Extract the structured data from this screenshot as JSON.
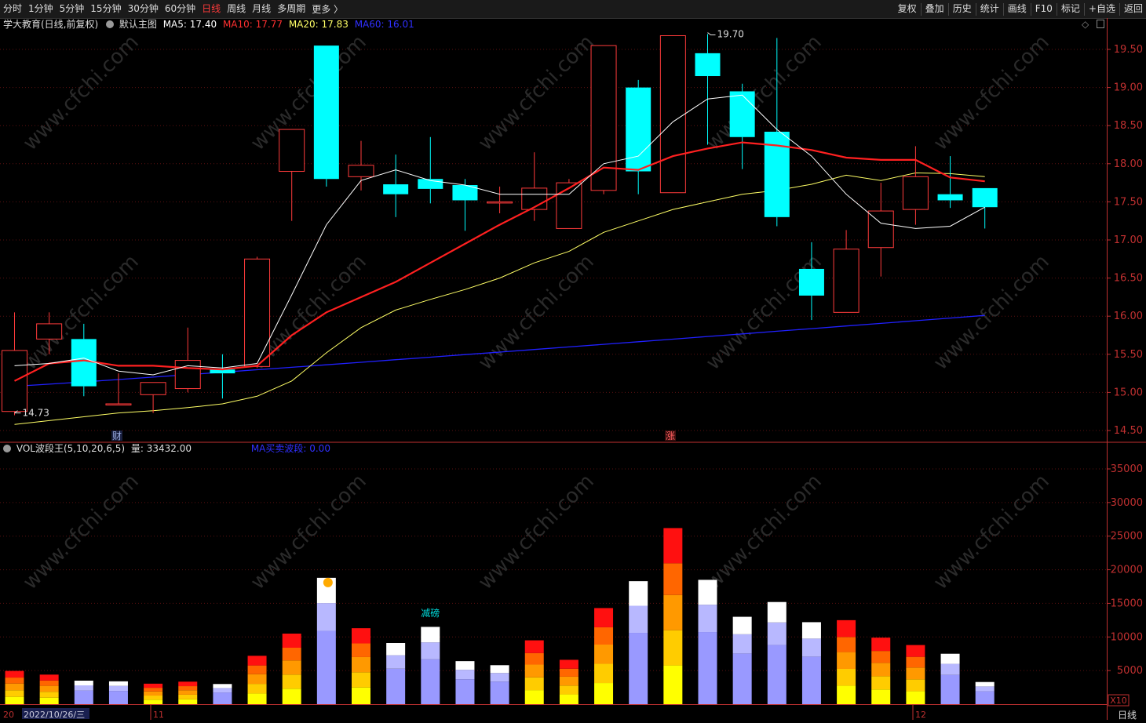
{
  "toolbar": {
    "periods": [
      {
        "label": "分时",
        "active": false
      },
      {
        "label": "1分钟",
        "active": false
      },
      {
        "label": "5分钟",
        "active": false
      },
      {
        "label": "15分钟",
        "active": false
      },
      {
        "label": "30分钟",
        "active": false
      },
      {
        "label": "60分钟",
        "active": false
      },
      {
        "label": "日线",
        "active": true
      },
      {
        "label": "周线",
        "active": false
      },
      {
        "label": "月线",
        "active": false
      },
      {
        "label": "多周期",
        "active": false
      }
    ],
    "more_label": "更多",
    "more_icon": "chevron-right-icon",
    "right_tools": [
      "复权",
      "叠加",
      "历史",
      "统计",
      "画线",
      "F10",
      "标记",
      "+自选",
      "返回"
    ]
  },
  "main_header": {
    "stock": "学大教育(日线,前复权)",
    "indicator": "默认主图",
    "ma5": "MA5: 17.40",
    "ma10": "MA10: 17.77",
    "ma20": "MA20: 17.83",
    "ma60": "MA60: 16.01"
  },
  "vol_header": {
    "name": "VOL波段王(5,10,20,6,5)",
    "volume": "量: 33432.00",
    "ma_label": "MA买卖波段: 0.00"
  },
  "annotations": {
    "high_label": "19.70",
    "low_label": "14.73",
    "cai_mark": "财",
    "zhang_mark": "涨",
    "jianbang": "减磅"
  },
  "bottom": {
    "date_label": "2022/10/26/三",
    "month_11": "11",
    "month_12": "12",
    "x10": "X10",
    "period_label": "日线",
    "left_mark": "20"
  },
  "colors": {
    "bull": "#ff3b3b",
    "bear": "#00ffff",
    "ma5": "#ffffff",
    "ma10": "#ff2020",
    "ma20": "#ffff66",
    "ma60": "#2020ff",
    "axis": "#c03030",
    "grid": "#5a1010"
  },
  "chart_data": [
    {
      "type": "candlestick",
      "y_ticks": [
        14.5,
        15.0,
        15.5,
        16.0,
        16.5,
        17.0,
        17.5,
        18.0,
        18.5,
        19.0,
        19.5
      ],
      "candles": [
        {
          "o": 14.75,
          "h": 16.05,
          "l": 14.7,
          "c": 15.55
        },
        {
          "o": 15.7,
          "h": 16.05,
          "l": 15.5,
          "c": 15.9
        },
        {
          "o": 15.7,
          "h": 15.9,
          "l": 14.95,
          "c": 15.08
        },
        {
          "o": 14.85,
          "h": 15.25,
          "l": 14.83,
          "c": 14.85
        },
        {
          "o": 14.97,
          "h": 15.1,
          "l": 14.73,
          "c": 15.13
        },
        {
          "o": 15.05,
          "h": 15.85,
          "l": 15.0,
          "c": 15.42
        },
        {
          "o": 15.3,
          "h": 15.5,
          "l": 14.92,
          "c": 15.25
        },
        {
          "o": 15.34,
          "h": 16.78,
          "l": 15.32,
          "c": 16.75
        },
        {
          "o": 17.9,
          "h": 18.45,
          "l": 17.25,
          "c": 18.45
        },
        {
          "o": 19.55,
          "h": 19.55,
          "l": 17.7,
          "c": 17.8
        },
        {
          "o": 17.83,
          "h": 18.3,
          "l": 17.65,
          "c": 17.98
        },
        {
          "o": 17.73,
          "h": 18.12,
          "l": 17.3,
          "c": 17.6
        },
        {
          "o": 17.8,
          "h": 18.35,
          "l": 17.48,
          "c": 17.67
        },
        {
          "o": 17.72,
          "h": 17.8,
          "l": 17.12,
          "c": 17.52
        },
        {
          "o": 17.5,
          "h": 17.7,
          "l": 17.35,
          "c": 17.5
        },
        {
          "o": 17.4,
          "h": 18.15,
          "l": 17.25,
          "c": 17.68
        },
        {
          "o": 17.15,
          "h": 17.8,
          "l": 17.15,
          "c": 17.75
        },
        {
          "o": 17.65,
          "h": 19.55,
          "l": 17.6,
          "c": 19.55
        },
        {
          "o": 19.0,
          "h": 19.1,
          "l": 17.6,
          "c": 17.9
        },
        {
          "o": 17.62,
          "h": 19.68,
          "l": 17.62,
          "c": 19.68
        },
        {
          "o": 19.45,
          "h": 19.7,
          "l": 18.25,
          "c": 19.15
        },
        {
          "o": 18.95,
          "h": 19.05,
          "l": 17.93,
          "c": 18.35
        },
        {
          "o": 18.42,
          "h": 19.65,
          "l": 17.18,
          "c": 17.3
        },
        {
          "o": 16.62,
          "h": 16.97,
          "l": 15.95,
          "c": 16.27
        },
        {
          "o": 16.05,
          "h": 17.13,
          "l": 16.05,
          "c": 16.88
        },
        {
          "o": 16.9,
          "h": 17.75,
          "l": 16.52,
          "c": 17.38
        },
        {
          "o": 17.4,
          "h": 18.23,
          "l": 17.2,
          "c": 17.83
        },
        {
          "o": 17.6,
          "h": 18.1,
          "l": 17.42,
          "c": 17.52
        },
        {
          "o": 17.68,
          "h": 17.68,
          "l": 17.15,
          "c": 17.43
        }
      ],
      "ma5": [
        15.35,
        15.38,
        15.45,
        15.28,
        15.23,
        15.35,
        15.32,
        15.38,
        16.28,
        17.2,
        17.78,
        17.92,
        17.78,
        17.72,
        17.6,
        17.6,
        17.6,
        18.0,
        18.1,
        18.55,
        18.85,
        18.9,
        18.45,
        18.1,
        17.6,
        17.22,
        17.15,
        17.18,
        17.43
      ],
      "ma10": [
        15.15,
        15.38,
        15.42,
        15.35,
        15.35,
        15.32,
        15.3,
        15.35,
        15.75,
        16.05,
        16.25,
        16.45,
        16.7,
        16.95,
        17.2,
        17.43,
        17.68,
        17.95,
        17.92,
        18.1,
        18.2,
        18.28,
        18.24,
        18.18,
        18.08,
        18.05,
        18.05,
        17.82,
        17.77
      ],
      "ma20": [
        14.58,
        14.63,
        14.68,
        14.73,
        14.76,
        14.8,
        14.85,
        14.95,
        15.15,
        15.52,
        15.85,
        16.08,
        16.22,
        16.35,
        16.5,
        16.7,
        16.85,
        17.1,
        17.25,
        17.4,
        17.5,
        17.6,
        17.65,
        17.73,
        17.85,
        17.78,
        17.88,
        17.87,
        17.83
      ],
      "ma60_start": 15.08,
      "ma60_end": 16.01,
      "high": 19.7,
      "low": 14.73
    },
    {
      "type": "bar",
      "title": "VOL",
      "y_ticks": [
        5000,
        10000,
        15000,
        20000,
        25000,
        30000,
        35000
      ],
      "values": [
        4950,
        4400,
        3500,
        3400,
        3050,
        3350,
        3000,
        7200,
        10500,
        18800,
        11300,
        9100,
        11500,
        6400,
        5800,
        9500,
        6600,
        14300,
        18300,
        26200,
        18500,
        13000,
        15200,
        12200,
        12500,
        9900,
        8800,
        7500,
        3300
      ],
      "up": [
        true,
        true,
        false,
        false,
        true,
        true,
        false,
        true,
        true,
        false,
        true,
        false,
        false,
        false,
        false,
        true,
        true,
        true,
        false,
        true,
        false,
        false,
        false,
        false,
        true,
        true,
        true,
        false,
        false
      ]
    }
  ]
}
